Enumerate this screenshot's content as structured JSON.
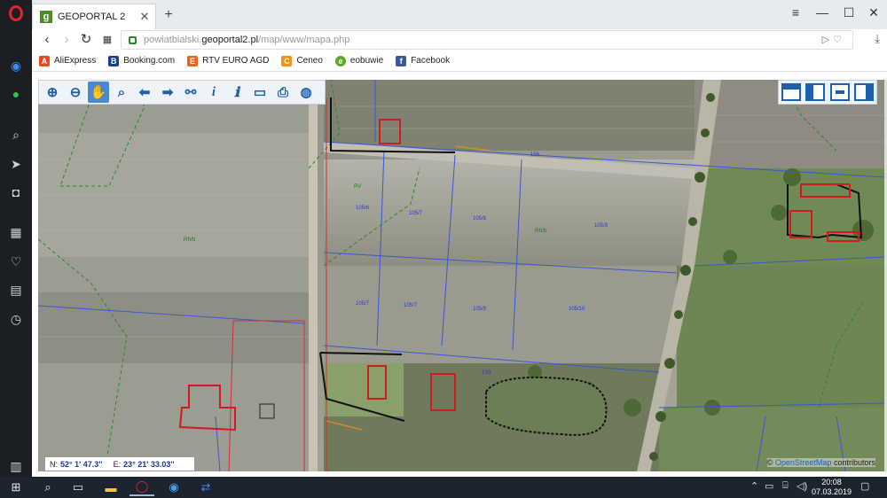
{
  "browser": {
    "tab_title": "GEOPORTAL 2",
    "tab_favicon": "g",
    "url_host_prefix": "powiatbialski.",
    "url_host_main": "geoportal2.pl",
    "url_path": "/map/www/mapa.php"
  },
  "bookmarks": [
    {
      "label": "AliExpress",
      "icon": "A",
      "color": "#e8481c"
    },
    {
      "label": "Booking.com",
      "icon": "B",
      "color": "#1d3f8c"
    },
    {
      "label": "RTV EURO AGD",
      "icon": "E",
      "color": "#e8641c"
    },
    {
      "label": "Ceneo",
      "icon": "C",
      "color": "#f29015"
    },
    {
      "label": "eobuwie",
      "icon": "e",
      "color": "#5aa82a"
    },
    {
      "label": "Facebook",
      "icon": "f",
      "color": "#3b5998"
    }
  ],
  "map": {
    "parcel_labels": [
      "RV",
      "RIVb",
      "RIVb",
      "156",
      "105/6",
      "105/7",
      "105/8",
      "105/7",
      "105/8",
      "105/9",
      "105/7",
      "105/10",
      "1S5"
    ]
  },
  "status": {
    "lat_label": "N:",
    "lat_value": "52° 1' 47.3''",
    "lon_label": "E:",
    "lon_value": "23° 21' 33.03''",
    "attribution_osm": "OpenStreetMap",
    "attribution_rest": "contributors",
    "attribution_prefix": "©"
  },
  "taskbar": {
    "time": "20:08",
    "date": "07.03.2019"
  }
}
